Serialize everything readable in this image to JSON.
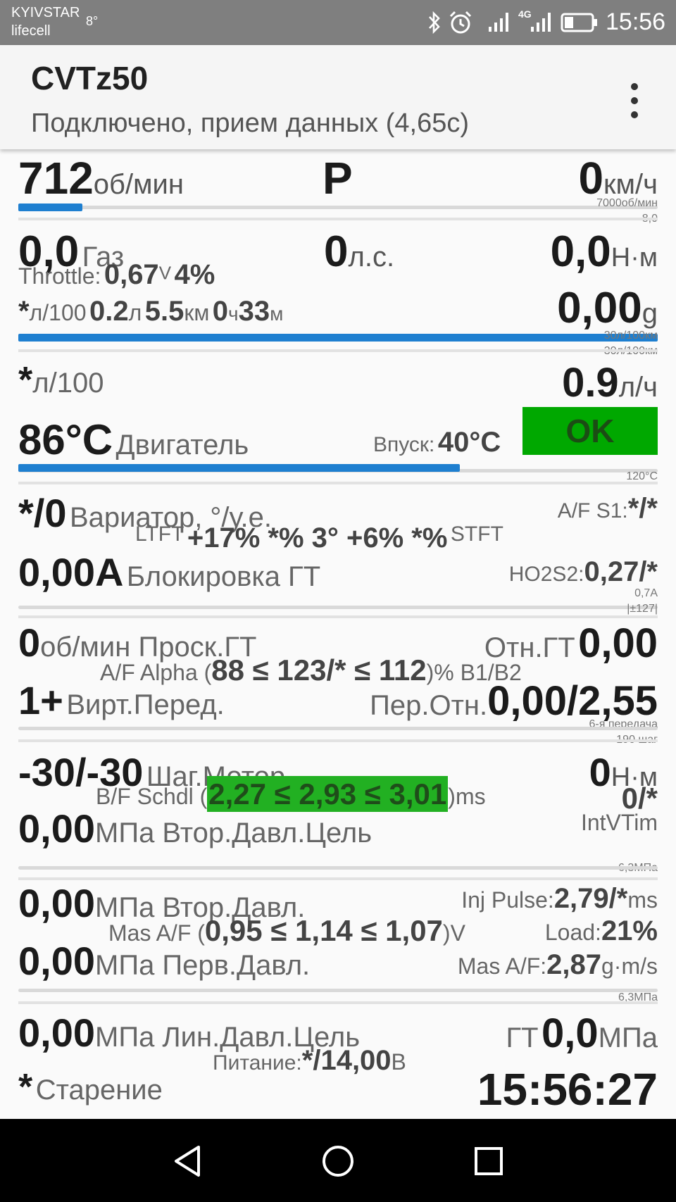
{
  "status_bar": {
    "carrier1": "KYIVSTAR",
    "carrier2": "lifecell",
    "temp": "8°",
    "network": "4G",
    "time": "15:56",
    "icons": [
      "bluetooth-icon",
      "alarm-icon",
      "signal-icon",
      "signal-4g-icon",
      "battery-icon"
    ]
  },
  "app_bar": {
    "title": "CVTz50",
    "subtitle": "Подключено, прием данных (4,65с)",
    "menu_icon": "overflow-menu-icon"
  },
  "rpm": {
    "value": "712",
    "unit": "об/мин",
    "bar_fraction": 0.1,
    "max_label": "7000об/мин",
    "sub_label": "8,0"
  },
  "gear": {
    "value": "P"
  },
  "speed": {
    "value": "0",
    "unit": "км/ч"
  },
  "gas": {
    "value": "0,0",
    "label": "Газ"
  },
  "power": {
    "value": "0",
    "unit": "л.с."
  },
  "torque": {
    "value": "0,0",
    "unit": "Н·м"
  },
  "throttle": {
    "label": "Throttle:",
    "volts": "0,67",
    "volts_unit": "V",
    "percent": "4%"
  },
  "trip": {
    "prefix": "*",
    "unit1": "л/100",
    "liters": "0.2",
    "l_unit": "л",
    "km": "5.5",
    "km_unit": "км",
    "hours": "0",
    "h_unit": "ч",
    "minutes": "33",
    "m_unit": "м"
  },
  "grams": {
    "value": "0,00",
    "unit": "g"
  },
  "fuel_bar": {
    "fraction": 1.0,
    "label1": "30л/100км",
    "label2": "30л/100км"
  },
  "consumption": {
    "prefix": "*",
    "unit": "л/100",
    "rate": "0.9",
    "rate_unit": "л/ч"
  },
  "engine_temp": {
    "value": "86°C",
    "label": "Двигатель",
    "bar_fraction": 0.69,
    "max_label": "120°C"
  },
  "intake": {
    "label": "Впуск:",
    "value": "40°C"
  },
  "status_badge": {
    "text": "OK",
    "color": "#00a800"
  },
  "variator": {
    "value": "*/0",
    "label": "Вариатор, °/у.е.",
    "af_label": "A/F S1:",
    "af_value": "*/*"
  },
  "fuel_trim": {
    "ltft_label": "LTFT",
    "values": "+17% *% 3° +6% *%",
    "stft_label": "STFT"
  },
  "lockup": {
    "value": "0,00A",
    "label": "Блокировка ГТ",
    "ho2s2_label": "HO2S2:",
    "ho2s2_value": "0,27/*",
    "tiny1": "0,7A",
    "tiny2": "|±127|"
  },
  "slip": {
    "value": "0",
    "label": "об/мин Проск.ГТ",
    "ratio_label": "Отн.ГТ",
    "ratio_value": "0,00"
  },
  "af_alpha": {
    "label": "A/F Alpha (",
    "values": "88 ≤ 123/* ≤ 112",
    "suffix": ")% B1/B2"
  },
  "virt_gear": {
    "value": "1+",
    "label": "Вирт.Перед.",
    "ratio_label": "Пер.Отн.",
    "ratio_value": "0,00/2,55",
    "tiny1": "6-я передача",
    "tiny2": "190 шаг"
  },
  "stepper": {
    "value": "-30/-30",
    "label": "Шаг.Мотор",
    "torque_value": "0",
    "torque_unit": "Н·м"
  },
  "bf_schdl": {
    "label": "B/F Schdl (",
    "values": "2,27 ≤ 2,93 ≤ 3,01",
    "suffix": ")ms",
    "highlight": "#22b022"
  },
  "intvtim": {
    "value": "0/*",
    "label": "IntVTim"
  },
  "sec_target": {
    "value": "0,00",
    "label": "МПа Втор.Давл.Цель",
    "tiny": "6,3МПа"
  },
  "sec_pressure": {
    "value": "0,00",
    "label": "МПа Втор.Давл.",
    "inj_label": "Inj Pulse:",
    "inj_value": "2,79/*",
    "inj_unit": "ms"
  },
  "mas_af_range": {
    "label": "Mas A/F (",
    "values": "0,95 ≤ 1,14 ≤ 1,07",
    "suffix": ")V",
    "load_label": "Load:",
    "load_value": "21%"
  },
  "pri_pressure": {
    "value": "0,00",
    "label": "МПа Перв.Давл.",
    "mas_label": "Mas A/F:",
    "mas_value": "2,87",
    "mas_unit": "g·m/s",
    "tiny": "6,3МПа"
  },
  "line_target": {
    "value": "0,00",
    "label": "МПа Лин.Давл.Цель",
    "gt_label": "ГТ",
    "gt_value": "0,0",
    "gt_unit": "МПа"
  },
  "supply": {
    "label": "Питание:",
    "value": "*/14,00",
    "unit": "В"
  },
  "aging": {
    "prefix": "*",
    "label": "Старение"
  },
  "clock": {
    "value": "15:56:27"
  },
  "nav_bar": {
    "icons": [
      "back-icon",
      "home-icon",
      "recents-icon"
    ]
  }
}
